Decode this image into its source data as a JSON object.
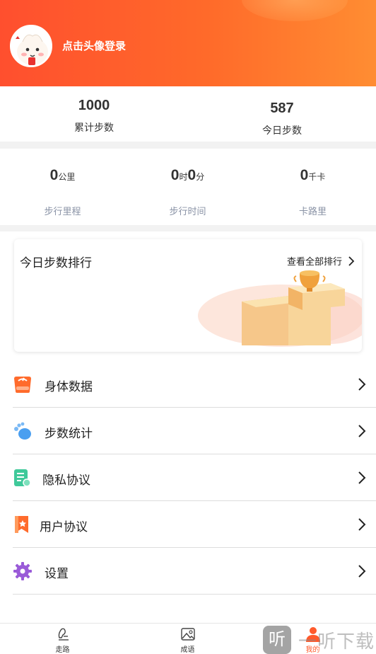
{
  "header": {
    "login_text": "点击头像登录"
  },
  "steps": {
    "total": {
      "value": "1000",
      "label": "累计步数"
    },
    "today": {
      "value": "587",
      "label": "今日步数"
    }
  },
  "stats": {
    "distance": {
      "value": "0",
      "unit": "公里",
      "label": "步行里程"
    },
    "time": {
      "hours": "0",
      "hours_unit": "时",
      "minutes": "0",
      "minutes_unit": "分",
      "label": "步行时间"
    },
    "calories": {
      "value": "0",
      "unit": "千卡",
      "label": "卡路里"
    }
  },
  "ranking": {
    "title": "今日步数排行",
    "view_all": "查看全部排行"
  },
  "menu": [
    {
      "label": "身体数据",
      "icon": "scale-icon",
      "color": "#ff6b2c"
    },
    {
      "label": "步数统计",
      "icon": "footprint-icon",
      "color": "#4a9ff0"
    },
    {
      "label": "隐私协议",
      "icon": "document-icon",
      "color": "#3fc99a"
    },
    {
      "label": "用户协议",
      "icon": "bookmark-icon",
      "color": "#ff6b2c"
    },
    {
      "label": "设置",
      "icon": "gear-icon",
      "color": "#9a5bd8"
    }
  ],
  "tabbar": {
    "tabs": [
      {
        "label": "走路",
        "icon": "walk-icon"
      },
      {
        "label": "成语",
        "icon": "image-icon"
      },
      {
        "label": "我的",
        "icon": "profile-icon",
        "active": true
      }
    ]
  },
  "watermark": {
    "logo": "听",
    "text": "一听下载"
  },
  "colors": {
    "header_start": "#ff4f2e",
    "header_end": "#ff8d32",
    "accent": "#ff5a2c",
    "muted": "#8a93a6"
  }
}
